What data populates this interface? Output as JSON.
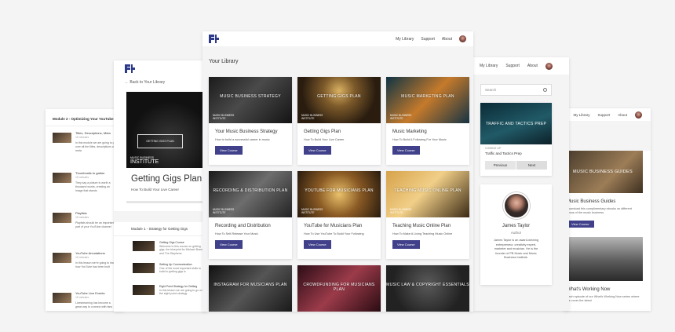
{
  "colors": {
    "accent": "#40418a",
    "logo": "#2d3a8c"
  },
  "module_panel": {
    "header": "Module 2 - Optimizing Your YouTube",
    "rows": [
      {
        "title": "Titles, Descriptions, Meta",
        "meta": "15 minutes",
        "desc": "In this module we are going to go over all the titles, descriptions and meta"
      },
      {
        "title": "Thumbnails to gather",
        "meta": "15 minutes",
        "desc": "They say a picture is worth a thousand words, creating an image that stands"
      },
      {
        "title": "Playlists",
        "meta": "15 minutes",
        "desc": "Playlists should be an important part of your YouTube channel"
      },
      {
        "title": "YouTube Annotations",
        "meta": "15 minutes",
        "desc": "In this lesson we're going to learn how YouTube has been built"
      },
      {
        "title": "YouTube Live Events",
        "meta": "15 minutes",
        "desc": "Livestreaming has become a great way to connect with fans"
      }
    ]
  },
  "course_panel": {
    "back": "← Back to Your Library",
    "hero_frame": "GETTING GIGS PLAN",
    "hero_brand_small": "MUSIC BUSINESS",
    "hero_brand": "INSTITUTE",
    "title": "Getting Gigs Plan",
    "subtitle": "How To Build Your Live Career",
    "module_header": "Module 1 - Strategy for Getting Gigs",
    "lessons": [
      {
        "title": "Getting Gigs Course",
        "desc": "Welcome to this course on getting gigs, the blueprint for Michael Brandt, and The Stephens"
      },
      {
        "title": "Setting Up Communication",
        "desc": "One of the most important skills to build to getting gigs is"
      },
      {
        "title": "Eight Point Strategy for Getting",
        "desc": "In this lesson we are going to go over the eight point strategy"
      }
    ]
  },
  "main_panel": {
    "nav": {
      "my_library": "My Library",
      "support": "Support",
      "about": "About"
    },
    "heading": "Your Library",
    "button_label": "View Course",
    "brand_line1": "MUSIC BUSINESS",
    "brand_line2": "INSTITUTE",
    "cards": [
      {
        "img_title": "MUSIC BUSINESS STRATEGY",
        "title": "Your Music Business Strategy",
        "desc": "How to build a successful career in music"
      },
      {
        "img_title": "GETTING GIGS PLAN",
        "title": "Getting Gigs Plan",
        "desc": "How To Build Your Live Career"
      },
      {
        "img_title": "MUSIC MARKETING PLAN",
        "title": "Music Marketing",
        "desc": "How To Build A Following For Your Music"
      },
      {
        "img_title": "RECORDING & DISTRIBUTION PLAN",
        "title": "Recording and Distribution",
        "desc": "How To Self-Release Your Music"
      },
      {
        "img_title": "YOUTUBE FOR MUSICIANS PLAN",
        "title": "YouTube for Musicians Plan",
        "desc": "How To Use YouTube To Build Your Following"
      },
      {
        "img_title": "TEACHING MUSIC ONLINE PLAN",
        "title": "Teaching Music Online Plan",
        "desc": "How To Make A Living Teaching Music Online"
      },
      {
        "img_title": "INSTAGRAM FOR MUSICIANS PLAN",
        "title": "",
        "desc": ""
      },
      {
        "img_title": "CROWDFUNDING FOR MUSICIANS PLAN",
        "title": "",
        "desc": ""
      },
      {
        "img_title": "MUSIC LAW & COPYRIGHT ESSENTIALS",
        "title": "",
        "desc": ""
      }
    ]
  },
  "side_panel": {
    "nav": {
      "my_library": "My Library",
      "support": "Support",
      "about": "About"
    },
    "search_placeholder": "Search",
    "feature_img": "TRAFFIC AND TACTICS PREP",
    "coming_up": "COMING UP",
    "feature_title": "Traffic and Tactics Prep",
    "previous": "Previous",
    "next": "Next",
    "author_name": "James Taylor",
    "author_role": "Author",
    "author_bio": "James Taylor is an award-winning entrepreneur, creativity expert, marketer and musician. He is the founder of PB Music and Music Business Institute."
  },
  "far_panel": {
    "nav": {
      "my_library": "My Library",
      "support": "Support",
      "about": "About"
    },
    "card1_img": "MUSIC BUSINESS GUIDES",
    "card1_title": "Music Business Guides",
    "card1_desc": "Download this complimentary ebooks on different areas of the music business.",
    "card1_btn": "View Course",
    "card2_title": "What's Working Now",
    "card2_desc": "Each episode of our What's Working Now series where we cover the latest"
  }
}
